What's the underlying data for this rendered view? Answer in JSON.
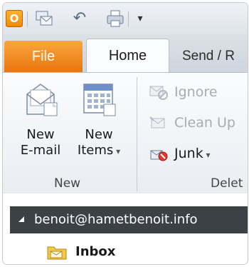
{
  "quick_access": {
    "outlook_glyph": "O",
    "customize_glyph": "▾",
    "icons": [
      "outlook-icon",
      "send-receive-icon",
      "undo-icon",
      "print-icon",
      "customize-toolbar-icon"
    ]
  },
  "tabs": {
    "file": "File",
    "home": "Home",
    "send_receive": "Send / R"
  },
  "ribbon": {
    "new_email": {
      "line1": "New",
      "line2": "E-mail"
    },
    "new_items": {
      "line1": "New",
      "line2": "Items"
    },
    "ignore": "Ignore",
    "clean_up": "Clean Up",
    "junk": "Junk",
    "group_new": "New",
    "group_delete": "Delet"
  },
  "nav": {
    "account": "benoit@hametbenoit.info",
    "inbox": "Inbox"
  },
  "colors": {
    "file_tab": "#e9750e",
    "account_bar": "#3c4148",
    "disabled_text": "#a6acb4"
  }
}
